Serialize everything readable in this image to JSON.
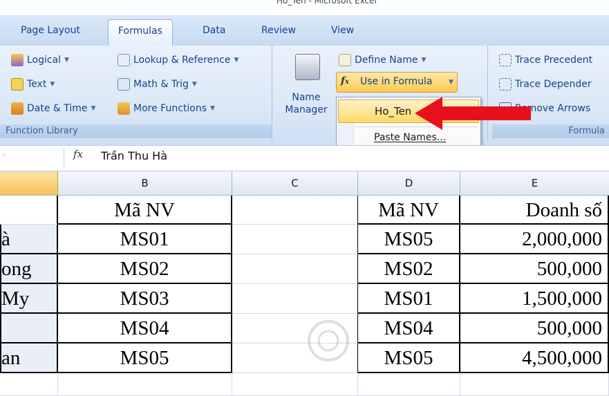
{
  "window": {
    "title": "Ho_Ten - Microsoft Excel"
  },
  "tabs": [
    "Page Layout",
    "Formulas",
    "Data",
    "Review",
    "View"
  ],
  "active_tab": "Formulas",
  "ribbon": {
    "function_library": {
      "caption": "Function Library",
      "items": [
        "Logical",
        "Text",
        "Date & Time",
        "Lookup & Reference",
        "Math & Trig",
        "More Functions"
      ]
    },
    "defined_names": {
      "name_manager_line1": "Name",
      "name_manager_line2": "Manager",
      "define_name": "Define Name",
      "use_in_formula": "Use in Formula"
    },
    "formula_auditing": {
      "caption": "Formula",
      "trace_precedents": "Trace Precedent",
      "trace_dependents": "Trace Depender",
      "remove_arrows": "Remove Arrows"
    }
  },
  "dropdown": {
    "items": [
      "Ho_Ten",
      "Paste Names..."
    ]
  },
  "formula_bar": {
    "fx": "fx",
    "value": "Trần Thu Hà"
  },
  "columns": [
    "B",
    "C",
    "D",
    "E"
  ],
  "grid": {
    "col_a": [
      "",
      "à",
      "ong",
      "My",
      "",
      "an"
    ],
    "col_b": [
      "Mã NV",
      "MS01",
      "MS02",
      "MS03",
      "MS04",
      "MS05"
    ],
    "col_d": [
      "Mã NV",
      "MS05",
      "MS02",
      "MS01",
      "MS04",
      "MS05"
    ],
    "col_e": [
      "Doanh số",
      "2,000,000",
      "500,000",
      "1,500,000",
      "500,000",
      "4,500,000"
    ]
  },
  "colors": {
    "ribbon_text": "#15428b",
    "highlight": "#ffd86b",
    "arrow": "#e8101c"
  }
}
